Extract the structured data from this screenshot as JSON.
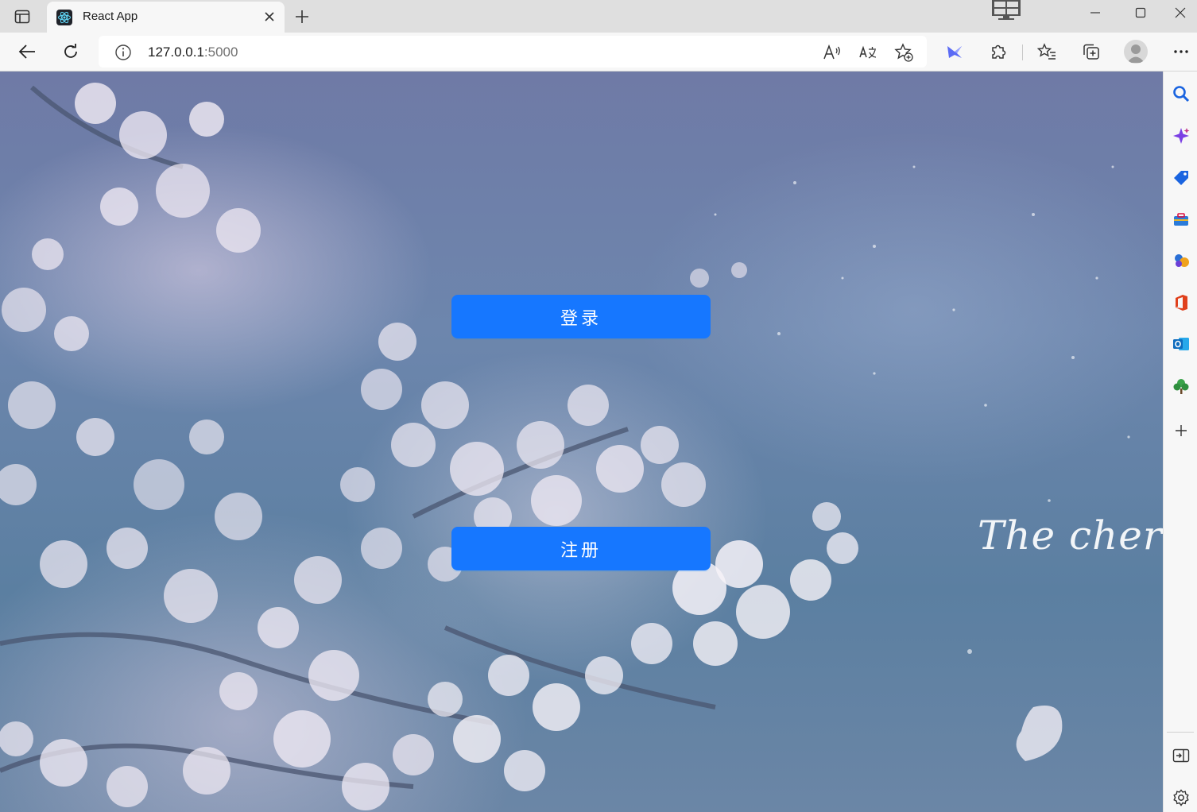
{
  "browser": {
    "tab": {
      "title": "React App"
    },
    "address": {
      "host": "127.0.0.1",
      "port": ":5000"
    }
  },
  "page": {
    "login_label": "登录",
    "register_label": "注册",
    "art_text": "The cherry"
  },
  "icons": {
    "tab_actions": "tab-actions-icon",
    "favicon": "react-logo-icon",
    "close": "close-icon",
    "new_tab": "plus-icon",
    "back": "back-arrow-icon",
    "refresh": "refresh-icon",
    "info": "info-icon",
    "read_aloud": "read-aloud-icon",
    "translate": "translate-icon",
    "add_favorite": "star-add-icon",
    "extensions": "puzzle-icon",
    "favorites": "favorites-icon",
    "collections": "collections-icon",
    "more": "more-icon",
    "sidebar": [
      "search-icon",
      "copilot-icon",
      "shopping-icon",
      "tools-icon",
      "games-icon",
      "office-icon",
      "outlook-icon",
      "tree-icon",
      "add-icon",
      "sidebar-toggle-icon",
      "settings-icon"
    ]
  },
  "colors": {
    "primary_button": "#1677ff",
    "chrome": "#f7f7f7",
    "tabstrip": "#dfdfdf"
  }
}
